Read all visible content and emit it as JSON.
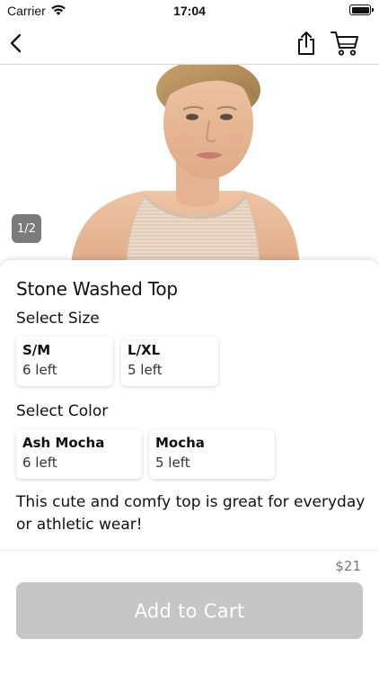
{
  "status_bar": {
    "carrier": "Carrier",
    "time": "17:04"
  },
  "nav": {
    "back_icon": "chevron-left-icon",
    "share_icon": "share-icon",
    "cart_icon": "cart-icon"
  },
  "gallery": {
    "counter": "1/2"
  },
  "product": {
    "title": "Stone Washed Top",
    "size_label": "Select Size",
    "sizes": [
      {
        "name": "S/M",
        "stock": "6 left"
      },
      {
        "name": "L/XL",
        "stock": "5 left"
      }
    ],
    "color_label": "Select Color",
    "colors": [
      {
        "name": "Ash Mocha",
        "stock": "6 left"
      },
      {
        "name": "Mocha",
        "stock": "5 left"
      }
    ],
    "description": "This cute and comfy top is great for everyday or athletic wear!"
  },
  "purchase": {
    "price": "$21",
    "button_label": "Add to Cart",
    "button_color": "#c6c6c6"
  }
}
